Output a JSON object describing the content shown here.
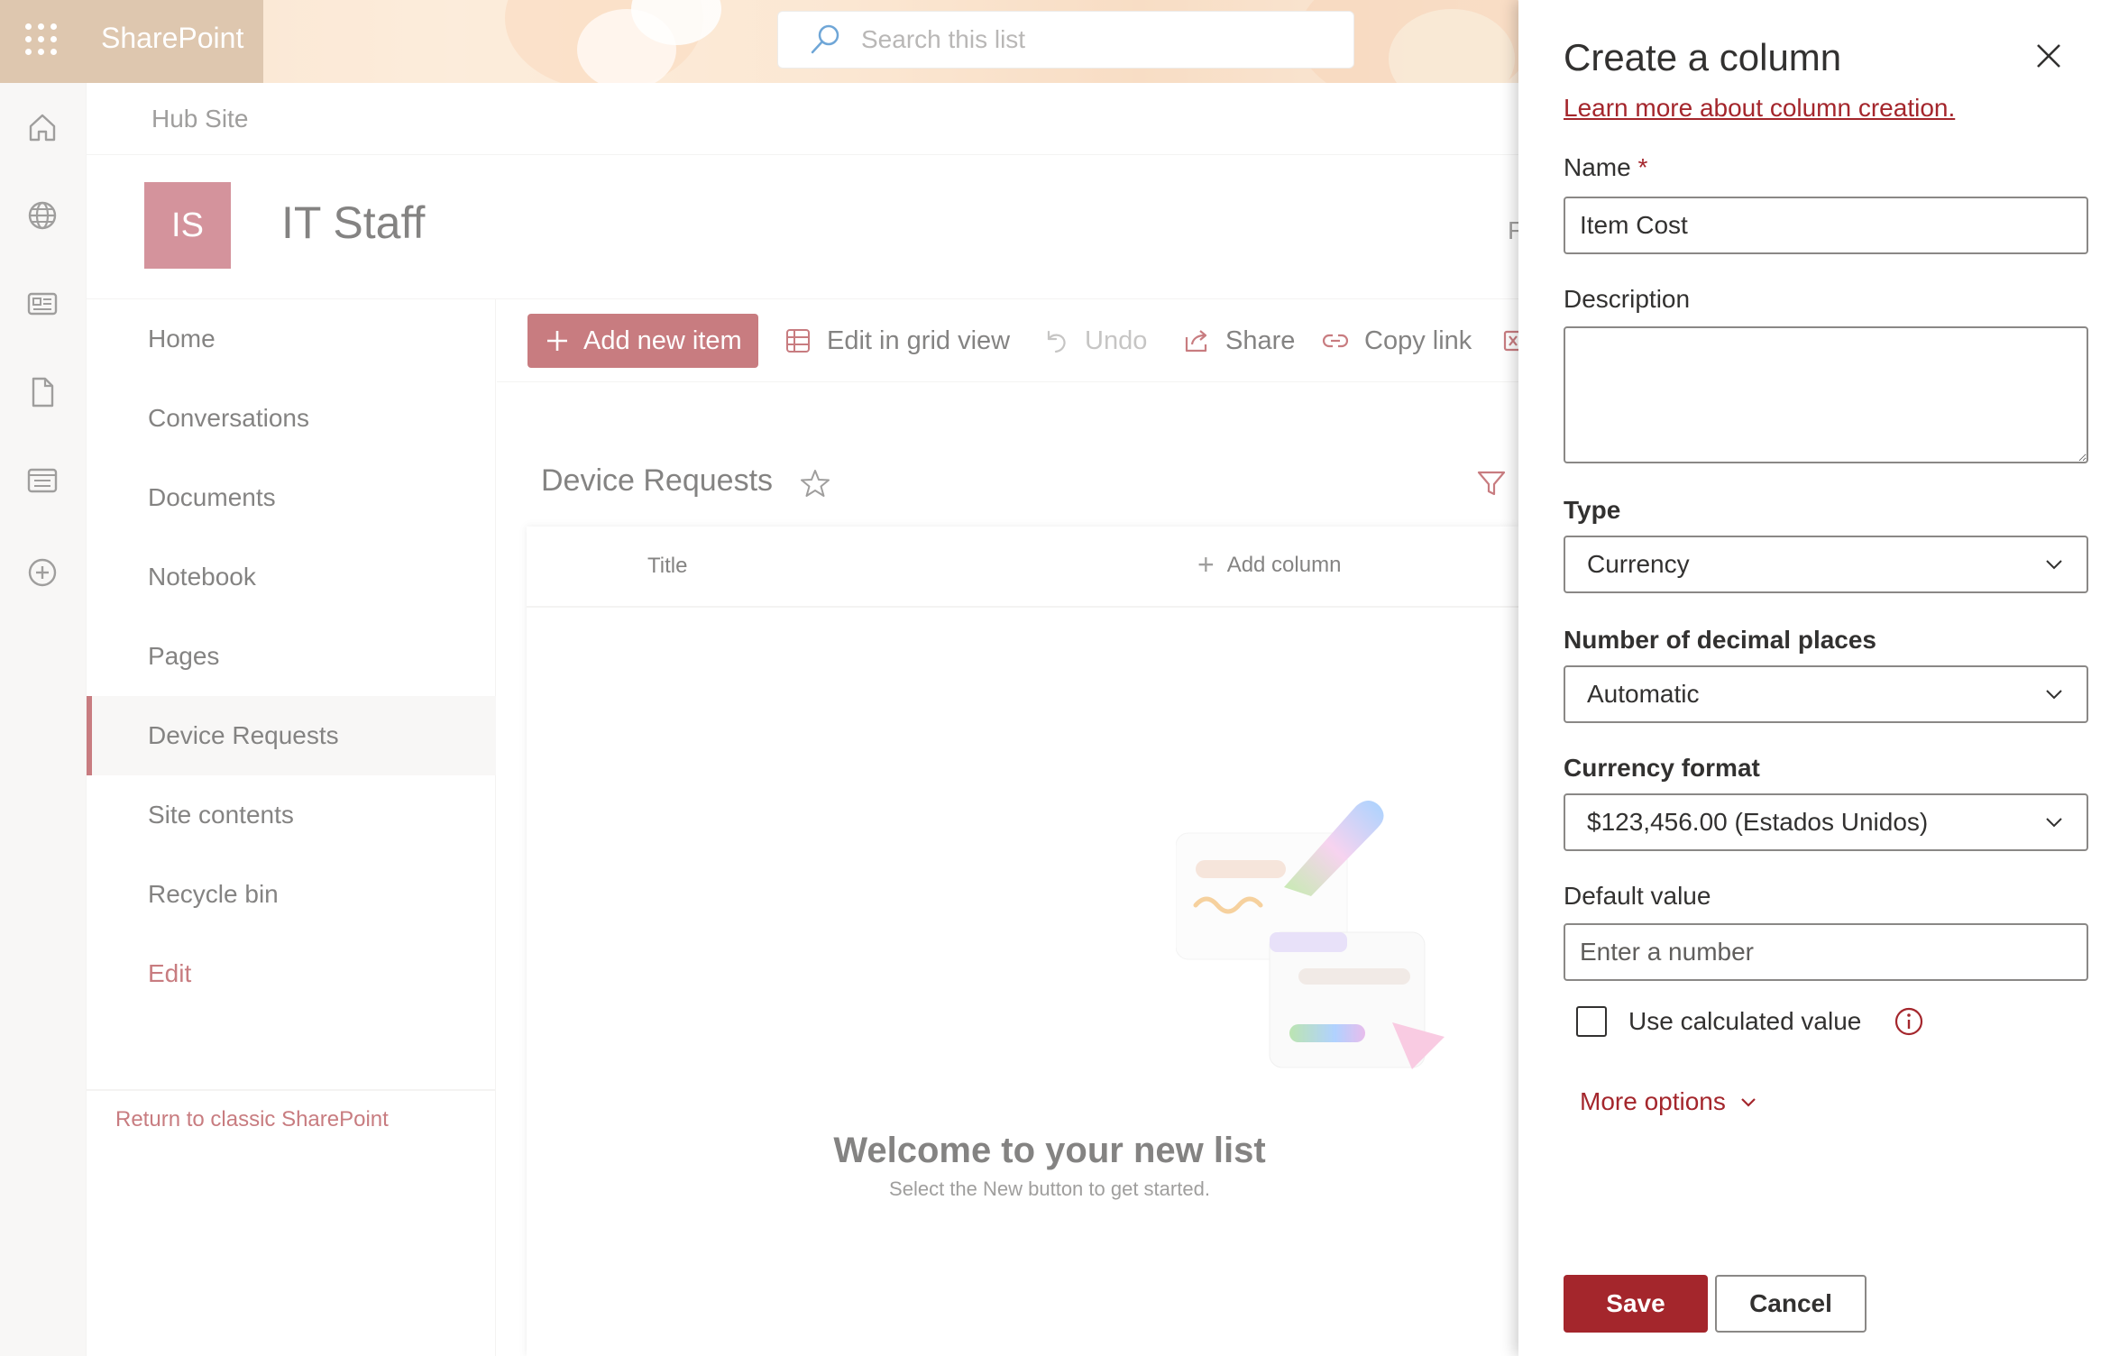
{
  "suite": {
    "brand": "SharePoint",
    "search_placeholder": "Search this list"
  },
  "hub": {
    "label": "Hub Site"
  },
  "site": {
    "logo_initials": "IS",
    "title": "IT Staff",
    "follow_partial": "F"
  },
  "leftnav": {
    "items": [
      {
        "label": "Home"
      },
      {
        "label": "Conversations"
      },
      {
        "label": "Documents"
      },
      {
        "label": "Notebook"
      },
      {
        "label": "Pages"
      },
      {
        "label": "Device Requests"
      },
      {
        "label": "Site contents"
      },
      {
        "label": "Recycle bin"
      },
      {
        "label": "Edit"
      }
    ],
    "active": "Device Requests",
    "classic_link": "Return to classic SharePoint"
  },
  "commandbar": {
    "add_new_item": "Add new item",
    "edit_grid": "Edit in grid view",
    "undo": "Undo",
    "share": "Share",
    "copy_link": "Copy link"
  },
  "list": {
    "title": "Device Requests",
    "columns": [
      "Title"
    ],
    "add_column": "Add column",
    "welcome_title": "Welcome to your new list",
    "welcome_sub": "Select the New button to get started."
  },
  "panel": {
    "title": "Create a column",
    "learn_more": "Learn more about column creation.",
    "name_label": "Name",
    "required_mark": "*",
    "name_value": "Item Cost",
    "description_label": "Description",
    "description_value": "",
    "type_label": "Type",
    "type_value": "Currency",
    "decimals_label": "Number of decimal places",
    "decimals_value": "Automatic",
    "currency_label": "Currency format",
    "currency_value": "$123,456.00 (Estados Unidos)",
    "default_label": "Default value",
    "default_placeholder": "Enter a number",
    "calculated_label": "Use calculated value",
    "more_options": "More options",
    "save": "Save",
    "cancel": "Cancel"
  },
  "colors": {
    "accent": "#a4262c",
    "logo_bg": "#b84c5a"
  }
}
